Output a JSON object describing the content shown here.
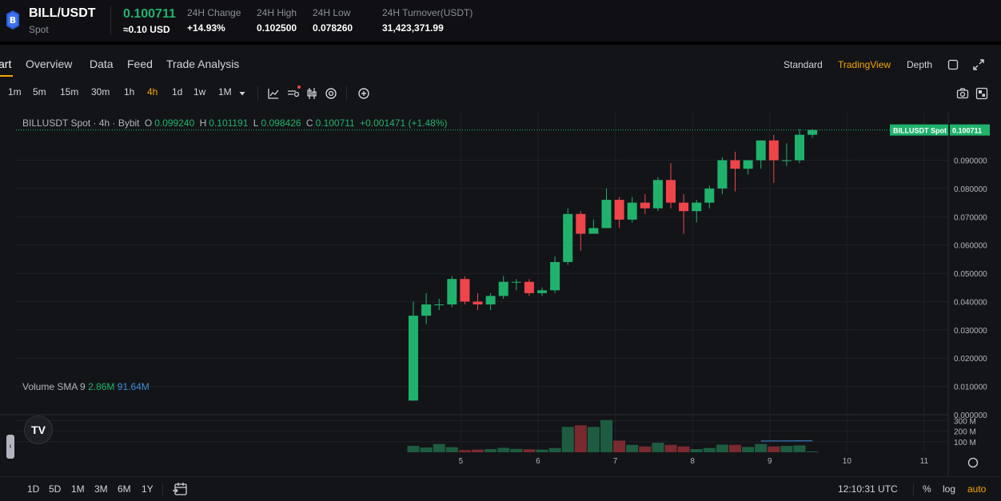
{
  "ticker": {
    "symbol": "BILL/USDT",
    "market": "Spot",
    "last_price": "0.100711",
    "last_price_usd": "≈0.10 USD",
    "stats": [
      {
        "label": "24H Change",
        "value": "+14.93%"
      },
      {
        "label": "24H High",
        "value": "0.102500"
      },
      {
        "label": "24H Low",
        "value": "0.078260"
      },
      {
        "label": "24H Turnover(USDT)",
        "value": "31,423,371.99"
      }
    ]
  },
  "tabs": [
    "art",
    "Overview",
    "Data",
    "Feed",
    "Trade Analysis"
  ],
  "view_modes": [
    "Standard",
    "TradingView",
    "Depth"
  ],
  "intervals": [
    "1m",
    "5m",
    "15m",
    "30m",
    "1h",
    "4h",
    "1d",
    "1w",
    "1M"
  ],
  "active_interval": "4h",
  "legend": {
    "title": "BILLUSDT Spot · 4h · Bybit",
    "o_label": "O",
    "o": "0.099240",
    "h_label": "H",
    "h": "0.101191",
    "l_label": "L",
    "l": "0.098426",
    "c_label": "C",
    "c": "0.100711",
    "change": "+0.001471 (+1.48%)"
  },
  "volume_legend": {
    "title": "Volume SMA 9",
    "volume": "2.86M",
    "sma": "91.64M"
  },
  "price_tag": {
    "label": "BILLUSDT Spot",
    "value": "0.100711"
  },
  "bottom": {
    "ranges": [
      "1D",
      "5D",
      "1M",
      "3M",
      "6M",
      "1Y"
    ],
    "time": "12:10:31 UTC",
    "options": [
      "%",
      "log",
      "auto"
    ]
  },
  "colors": {
    "up": "#20b26c",
    "down": "#ef454a",
    "accent": "#f7a600",
    "volume_up": "#1e5c41",
    "volume_down": "#7a2a2f",
    "sma": "#3d8fd6"
  },
  "chart_data": {
    "type": "candlestick",
    "price_ticks": [
      "0.090000",
      "0.080000",
      "0.070000",
      "0.060000",
      "0.050000",
      "0.040000",
      "0.030000",
      "0.020000",
      "0.010000",
      "0.000000"
    ],
    "volume_ticks": [
      "300 M",
      "200 M",
      "100 M"
    ],
    "x_ticks": [
      "5",
      "6",
      "7",
      "8",
      "9",
      "10",
      "11"
    ],
    "price_ylim": [
      0,
      0.104
    ],
    "volume_ylim": [
      0,
      310
    ],
    "candles": [
      {
        "o": 0.005,
        "h": 0.04,
        "l": 0.005,
        "c": 0.035,
        "v": 60
      },
      {
        "o": 0.035,
        "h": 0.043,
        "l": 0.032,
        "c": 0.039,
        "v": 45
      },
      {
        "o": 0.039,
        "h": 0.041,
        "l": 0.037,
        "c": 0.039,
        "v": 78
      },
      {
        "o": 0.039,
        "h": 0.049,
        "l": 0.038,
        "c": 0.048,
        "v": 48
      },
      {
        "o": 0.048,
        "h": 0.049,
        "l": 0.039,
        "c": 0.04,
        "v": 20
      },
      {
        "o": 0.04,
        "h": 0.043,
        "l": 0.037,
        "c": 0.039,
        "v": 25
      },
      {
        "o": 0.039,
        "h": 0.043,
        "l": 0.037,
        "c": 0.042,
        "v": 30
      },
      {
        "o": 0.042,
        "h": 0.049,
        "l": 0.041,
        "c": 0.047,
        "v": 42
      },
      {
        "o": 0.047,
        "h": 0.048,
        "l": 0.044,
        "c": 0.047,
        "v": 32
      },
      {
        "o": 0.047,
        "h": 0.048,
        "l": 0.042,
        "c": 0.043,
        "v": 28
      },
      {
        "o": 0.043,
        "h": 0.045,
        "l": 0.042,
        "c": 0.044,
        "v": 25
      },
      {
        "o": 0.044,
        "h": 0.056,
        "l": 0.043,
        "c": 0.054,
        "v": 40
      },
      {
        "o": 0.054,
        "h": 0.073,
        "l": 0.053,
        "c": 0.071,
        "v": 240
      },
      {
        "o": 0.071,
        "h": 0.072,
        "l": 0.058,
        "c": 0.064,
        "v": 255
      },
      {
        "o": 0.064,
        "h": 0.069,
        "l": 0.064,
        "c": 0.066,
        "v": 240
      },
      {
        "o": 0.066,
        "h": 0.08,
        "l": 0.066,
        "c": 0.076,
        "v": 305
      },
      {
        "o": 0.076,
        "h": 0.077,
        "l": 0.066,
        "c": 0.069,
        "v": 110
      },
      {
        "o": 0.069,
        "h": 0.077,
        "l": 0.068,
        "c": 0.075,
        "v": 70
      },
      {
        "o": 0.075,
        "h": 0.078,
        "l": 0.071,
        "c": 0.073,
        "v": 55
      },
      {
        "o": 0.073,
        "h": 0.084,
        "l": 0.072,
        "c": 0.083,
        "v": 90
      },
      {
        "o": 0.083,
        "h": 0.089,
        "l": 0.073,
        "c": 0.075,
        "v": 70
      },
      {
        "o": 0.075,
        "h": 0.078,
        "l": 0.064,
        "c": 0.072,
        "v": 55
      },
      {
        "o": 0.072,
        "h": 0.076,
        "l": 0.068,
        "c": 0.075,
        "v": 30
      },
      {
        "o": 0.075,
        "h": 0.081,
        "l": 0.073,
        "c": 0.08,
        "v": 40
      },
      {
        "o": 0.08,
        "h": 0.091,
        "l": 0.078,
        "c": 0.09,
        "v": 72
      },
      {
        "o": 0.09,
        "h": 0.093,
        "l": 0.079,
        "c": 0.087,
        "v": 70
      },
      {
        "o": 0.087,
        "h": 0.09,
        "l": 0.085,
        "c": 0.09,
        "v": 50
      },
      {
        "o": 0.09,
        "h": 0.097,
        "l": 0.087,
        "c": 0.097,
        "v": 78
      },
      {
        "o": 0.097,
        "h": 0.099,
        "l": 0.082,
        "c": 0.09,
        "v": 55
      },
      {
        "o": 0.09,
        "h": 0.096,
        "l": 0.088,
        "c": 0.09,
        "v": 60
      },
      {
        "o": 0.09,
        "h": 0.101,
        "l": 0.089,
        "c": 0.099,
        "v": 65
      },
      {
        "o": 0.099,
        "h": 0.101,
        "l": 0.098,
        "c": 0.1007,
        "v": 8
      }
    ],
    "sma_tail": [
      92,
      93,
      94,
      95,
      96,
      96,
      97,
      97,
      98,
      98,
      99,
      99,
      99,
      100,
      100,
      101,
      101,
      102,
      102,
      103,
      103,
      104,
      104,
      104,
      105,
      105,
      106,
      106,
      107,
      107,
      108,
      108
    ]
  }
}
